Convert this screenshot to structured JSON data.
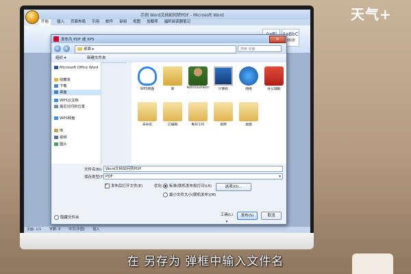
{
  "watermark": {
    "logo": "天气+"
  },
  "subtitle": "在 另存为 弹框中输入文件名",
  "word": {
    "window_title": "示例 Word文档如何转PDF - Microsoft Word",
    "ribbon_tabs": [
      "开始",
      "插入",
      "页面布局",
      "引用",
      "邮件",
      "审阅",
      "视图",
      "加载项",
      "福昕阅读器笔记"
    ],
    "active_tab": 0,
    "styles": [
      {
        "sample": "AaBl",
        "name": "标题"
      },
      {
        "sample": "AaBbC",
        "name": "副标题"
      }
    ],
    "status_items": [
      "页面: 1/1",
      "字数: 6",
      "中文(中国)",
      "插入"
    ]
  },
  "dialog": {
    "title": "发布为 PDF 或 XPS",
    "breadcrumb": "桌面",
    "search_placeholder": "搜索 桌面",
    "toolbar": {
      "organize": "组织 ▾",
      "new_folder": "新建文件夹"
    },
    "nav": [
      {
        "label": "Microsoft Office Word",
        "icon": "word-icon",
        "color": "#2b5797"
      },
      {
        "label": "收藏夹",
        "icon": "star-icon",
        "color": "#e6b63a"
      },
      {
        "label": "下载",
        "icon": "download-icon",
        "color": "#4a86c7"
      },
      {
        "label": "桌面",
        "icon": "desktop-icon",
        "color": "#4a7fbf",
        "selected": true
      },
      {
        "label": "WPS云文档",
        "icon": "cloud-icon",
        "color": "#3a8de0"
      },
      {
        "label": "最近访问的位置",
        "icon": "recent-icon",
        "color": "#6a8fb8"
      },
      {
        "label": "WPS网盘",
        "icon": "cloud-drive-icon",
        "color": "#3a8de0"
      },
      {
        "label": "库",
        "icon": "library-icon",
        "color": "#c9a44a"
      },
      {
        "label": "视频",
        "icon": "video-icon",
        "color": "#5a6f9a"
      },
      {
        "label": "图片",
        "icon": "picture-icon",
        "color": "#4a9a6a"
      }
    ],
    "files_row1": [
      {
        "label": "WPS网盘",
        "icon": "wps-cloud-icon"
      },
      {
        "label": "库",
        "icon": "library-folder-icon"
      },
      {
        "label": "Administrator",
        "icon": "user-icon"
      },
      {
        "label": "计算机",
        "icon": "computer-icon"
      },
      {
        "label": "网络",
        "icon": "network-icon"
      },
      {
        "label": "办公辅助",
        "icon": "office-assist-icon"
      }
    ],
    "files_row2": [
      {
        "label": "未命名",
        "icon": "folder-icon"
      },
      {
        "label": "已编辑",
        "icon": "folder-icon"
      },
      {
        "label": "每日工作",
        "icon": "folder-icon"
      },
      {
        "label": "视频",
        "icon": "folder-icon"
      },
      {
        "label": "桌面",
        "icon": "folder-icon"
      }
    ],
    "filename_label": "文件名(N):",
    "filename_value": "Word文档如何转PDF",
    "filetype_label": "保存类型(T):",
    "filetype_value": "PDF",
    "open_after_publish": "发布后打开文件(E)",
    "optimize_label": "优化:",
    "optimize_standard": "标准(联机发布和打印)(A)",
    "optimize_min": "最小文件大小(联机发布)(M)",
    "options_button": "选项(O)...",
    "hide_folders": "隐藏文件夹",
    "tools_button": "工具(L) ▾",
    "publish_button": "发布(S)",
    "cancel_button": "取消"
  }
}
